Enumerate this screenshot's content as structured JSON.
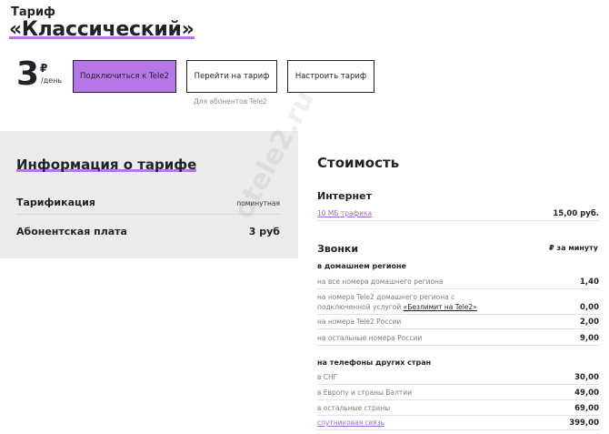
{
  "header": {
    "tariff_label": "Тариф",
    "tariff_name": "«Классический»"
  },
  "price": {
    "amount": "3",
    "currency": "₽",
    "period": "/день"
  },
  "buttons": {
    "connect": "Подключиться к Tele2",
    "switch": "Перейти на тариф",
    "setup": "Настроить тариф",
    "note": "Для абонентов Tele2"
  },
  "info": {
    "title": "Информация о тарифе",
    "billing_label": "Тарификация",
    "billing_value": "поминутная",
    "fee_label": "Абонентская плата",
    "fee_value": "3 руб"
  },
  "cost": {
    "title": "Стоимость",
    "internet": {
      "title": "Интернет",
      "rows": [
        {
          "desc": "10 МБ трафика",
          "price": "15,00 руб."
        }
      ]
    },
    "calls": {
      "title": "Звонки",
      "per_minute": "₽ за минуту",
      "home_region_title": "в домашнем регионе",
      "home_rows": [
        {
          "desc": "на все номера домашнего региона",
          "price": "1,40"
        },
        {
          "desc_line1": "на номера Tele2 домашнего региона с",
          "desc_line2_pre": "подключенной услугой ",
          "desc_link": "«Безлимит на Tele2»",
          "price": "0,00"
        },
        {
          "desc": "на номера Tele2 России",
          "price": "2,00"
        },
        {
          "desc": "на остальные номера России",
          "price": "9,00"
        }
      ],
      "foreign_title": "на телефоны других стран",
      "foreign_rows": [
        {
          "desc": "в СНГ",
          "price": "30,00"
        },
        {
          "desc": "в Европу и страны Балтии",
          "price": "49,00"
        },
        {
          "desc": "в остальные страны",
          "price": "69,00"
        },
        {
          "desc": "спутниковая связь",
          "price": "399,00"
        }
      ]
    }
  },
  "watermark": "otele2.ru",
  "colors": {
    "accent": "#b777e8",
    "panel": "#ebebeb",
    "text": "#1f2229"
  }
}
